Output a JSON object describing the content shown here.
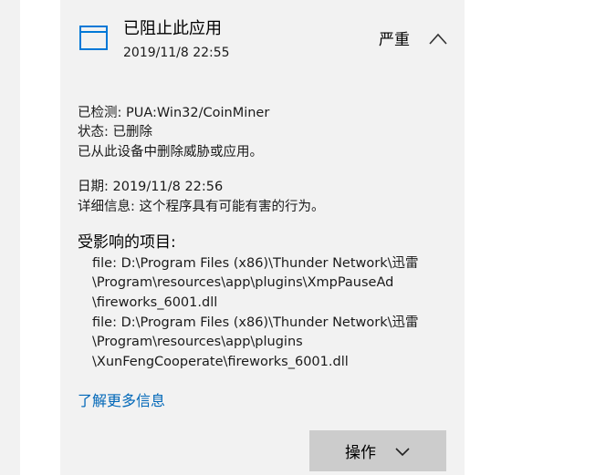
{
  "header": {
    "title": "已阻止此应用",
    "timestamp": "2019/11/8 22:55",
    "severity": "严重",
    "icon": "app-window-icon",
    "collapse_icon": "chevron-up-icon",
    "accent_color": "#0078d7"
  },
  "details": {
    "detected": "已检测:  PUA:Win32/CoinMiner",
    "status": "状态:  已删除",
    "removal_note": "已从此设备中删除威胁或应用。",
    "date": "日期:  2019/11/8 22:56",
    "description": "详细信息:  这个程序具有可能有害的行为。"
  },
  "affected": {
    "title": "受影响的项目:",
    "lines": [
      "file: D:\\Program Files (x86)\\Thunder Network\\迅雷",
      "\\Program\\resources\\app\\plugins\\XmpPauseAd",
      "\\fireworks_6001.dll",
      "file: D:\\Program Files (x86)\\Thunder Network\\迅雷",
      "\\Program\\resources\\app\\plugins",
      "\\XunFengCooperate\\fireworks_6001.dll"
    ]
  },
  "learn_more": "了解更多信息",
  "actions": {
    "label": "操作",
    "icon": "chevron-down-icon"
  }
}
